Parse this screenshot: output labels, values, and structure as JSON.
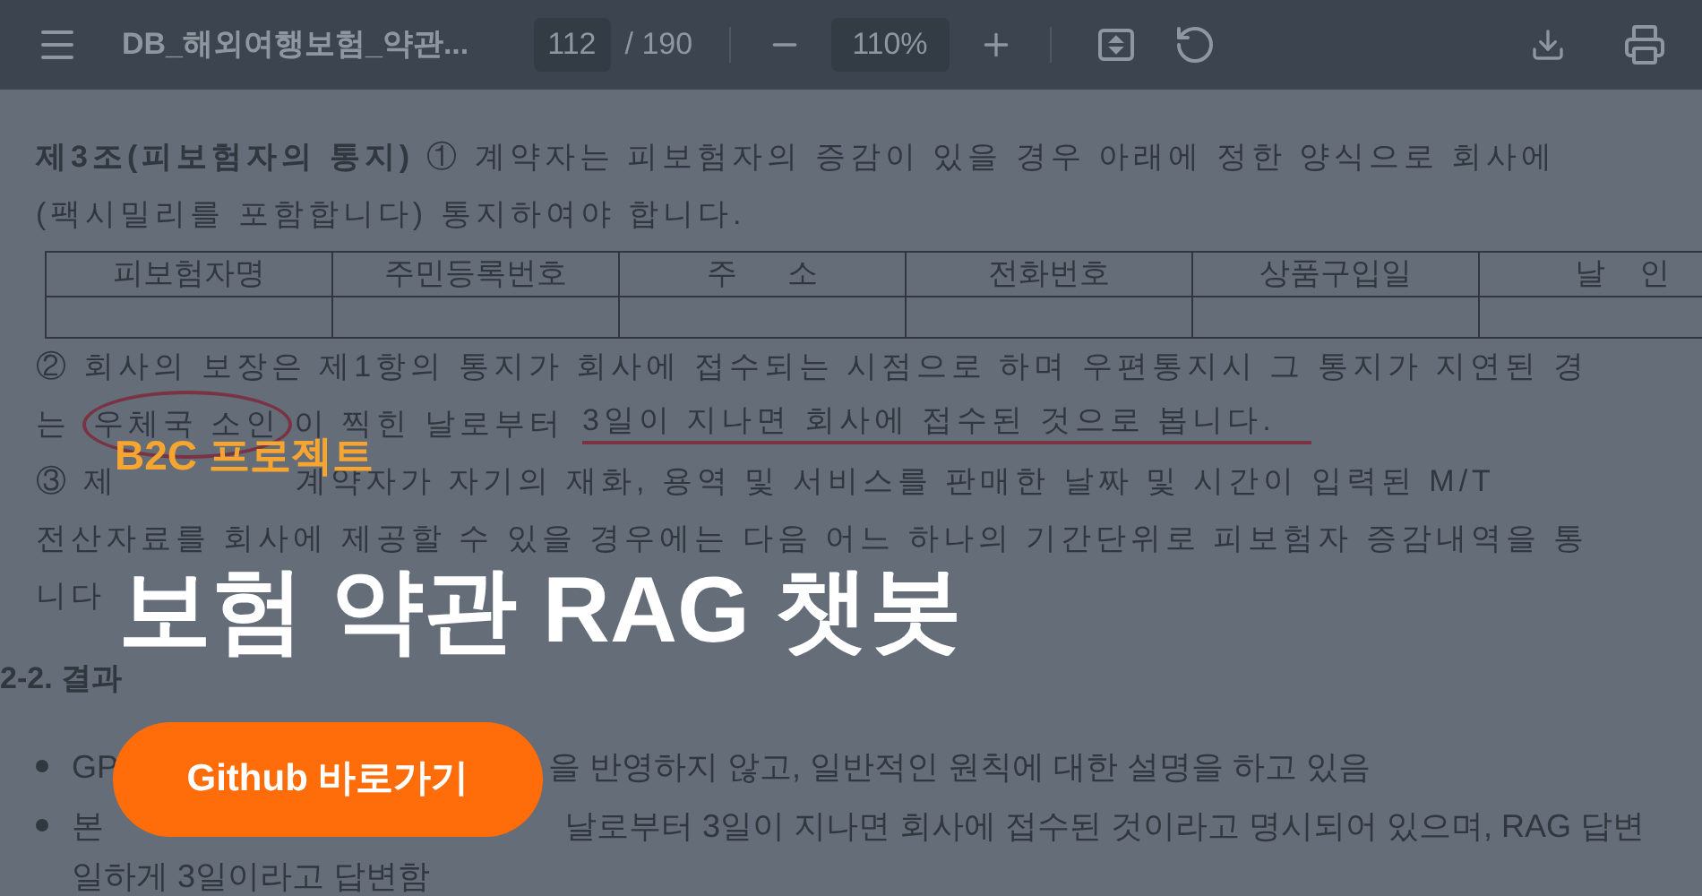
{
  "toolbar": {
    "file_name": "DB_해외여행보험_약관...",
    "page_input": "112",
    "page_total": "/ 190",
    "zoom": "110%"
  },
  "document": {
    "intro_lines": [
      "**제3조(피보험자의 통지)** ① 계약자는 피보험자의 증감이 있을 경우 아래에 정한 양식으로 회사에",
      "(팩시밀리를 포함합니다) 통지하여야 합니다."
    ],
    "table_columns": [
      "피보험자명",
      "주민등록번호",
      "주      소",
      "전화번호",
      "상품구입일",
      "날    인"
    ],
    "paragraph_lines": [
      {
        "segments": [
          {
            "text": "② 회사의 보장은 제1항의 통지가 회사에 접수되는 시점으로 하며 우편통지시 그 통지가 지연된 경",
            "kind": "plain"
          }
        ]
      },
      {
        "segments": [
          {
            "text": "는",
            "kind": "plain"
          },
          {
            "text": "우체국 소인",
            "kind": "circled"
          },
          {
            "text": "이 찍힌 날로부터",
            "kind": "plain"
          },
          {
            "text": "3일이 지나면 회사에 접수된 것으로 봅니다.",
            "kind": "underlined"
          }
        ]
      },
      {
        "segments": [
          {
            "text": "③ 제",
            "kind": "plain"
          },
          {
            "text": "계약자가 자기의 재화, 용역 및 서비스를 판매한 날짜 및 시간이 입력된 M/T",
            "kind": "plain"
          }
        ]
      },
      {
        "segments": [
          {
            "text": "전산자료를 회사에 제공할 수 있을 경우에는 다음 어느 하나의 기간단위로 피보험자 증감내역을 통",
            "kind": "plain"
          }
        ]
      },
      {
        "segments": [
          {
            "text": "니다",
            "kind": "plain"
          }
        ]
      }
    ],
    "section_heading": "2-2. 결과",
    "bullets": [
      {
        "segments": [
          "GP",
          "을 반영하지 않고, 일반적인 원칙에 대한 설명을 하고 있음"
        ]
      },
      {
        "segments": [
          "본",
          "날로부터 3일이 지나면 회사에 접수된 것이라고 명시되어 있으며, RAG 답변"
        ]
      }
    ],
    "continuation": "일하게 3일이라고 답변함"
  },
  "overlay": {
    "tag": "B2C 프로젝트",
    "title": "보험 약관 RAG 챗봇",
    "button": "Github 바로가기"
  }
}
